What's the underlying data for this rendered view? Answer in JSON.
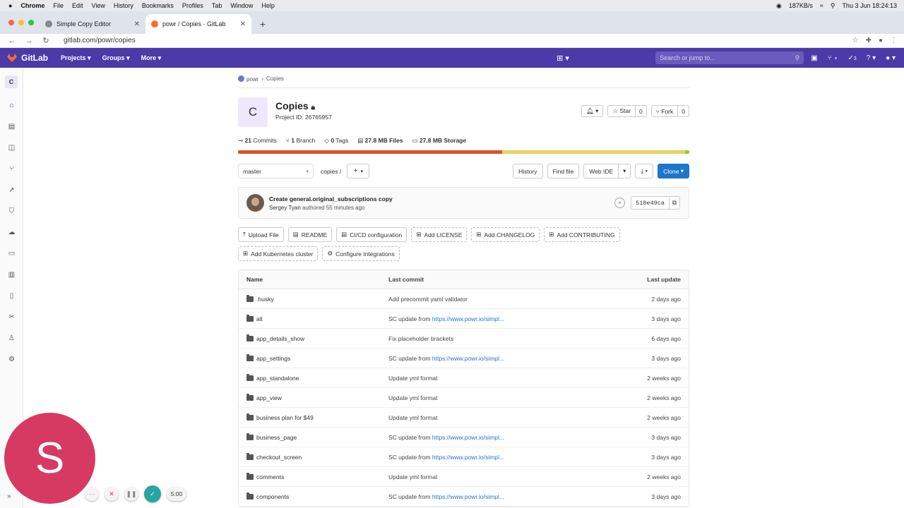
{
  "macos": {
    "apple": "",
    "menu": [
      "Chrome",
      "File",
      "Edit",
      "View",
      "History",
      "Bookmarks",
      "Profiles",
      "Tab",
      "Window",
      "Help"
    ],
    "network": "187KB/s",
    "datetime": "Thu 3 Jun  18:24:13"
  },
  "browser": {
    "tabs": [
      {
        "title": "Simple Copy Editor",
        "favicon_color": "#888888"
      },
      {
        "title": "powr / Copies · GitLab",
        "favicon_color": "#fc6d26"
      }
    ],
    "url": "gitlab.com/powr/copies"
  },
  "gitlab_nav": {
    "brand": "GitLab",
    "menu": [
      "Projects",
      "Groups",
      "More"
    ],
    "search_placeholder": "Search or jump to...",
    "todo_count": "3"
  },
  "sidebar": {
    "avatar_letter": "C"
  },
  "breadcrumb": {
    "group": "powr",
    "project": "Copies"
  },
  "project": {
    "avatar_letter": "C",
    "title": "Copies",
    "project_id": "Project ID: 26765957",
    "star_label": "Star",
    "star_count": "0",
    "fork_label": "Fork",
    "fork_count": "0"
  },
  "stats": {
    "commits_num": "21",
    "commits_label": "Commits",
    "branch_num": "1",
    "branch_label": "Branch",
    "tags_num": "0",
    "tags_label": "Tags",
    "files_num": "27.8 MB",
    "files_label": "Files",
    "storage_num": "27.8 MB",
    "storage_label": "Storage"
  },
  "language_bar": [
    {
      "color": "#d9512c",
      "fraction": 0.585
    },
    {
      "color": "#e6d35b",
      "fraction": 0.405
    },
    {
      "color": "#8ec63f",
      "fraction": 0.01
    }
  ],
  "toolbar": {
    "branch": "master",
    "path": "copies  /",
    "history": "History",
    "find_file": "Find file",
    "web_ide": "Web IDE",
    "clone": "Clone"
  },
  "last_commit": {
    "title": "Create general.original_subscriptions copy",
    "author": "Sergey Tyan",
    "meta": "authored 55 minutes ago",
    "sha": "518e49ca"
  },
  "quick_actions": [
    {
      "label": "Upload File",
      "style": "solid"
    },
    {
      "label": "README",
      "style": "solid"
    },
    {
      "label": "CI/CD configuration",
      "style": "solid"
    },
    {
      "label": "Add LICENSE",
      "style": "dashed"
    },
    {
      "label": "Add CHANGELOG",
      "style": "dashed"
    },
    {
      "label": "Add CONTRIBUTING",
      "style": "dashed"
    },
    {
      "label": "Add Kubernetes cluster",
      "style": "dashed"
    },
    {
      "label": "Configure Integrations",
      "style": "dashed"
    }
  ],
  "table": {
    "headers": {
      "name": "Name",
      "commit": "Last commit",
      "update": "Last update"
    },
    "rows": [
      {
        "name": ".husky",
        "commit": "Add precommit yaml validator",
        "link": "",
        "update": "2 days ago"
      },
      {
        "name": "all",
        "commit": "SC update from ",
        "link": "https://www.powr.io/simpl...",
        "update": "3 days ago"
      },
      {
        "name": "app_details_show",
        "commit": "Fix placeholder brackets",
        "link": "",
        "update": "6 days ago"
      },
      {
        "name": "app_settings",
        "commit": "SC update from ",
        "link": "https://www.powr.io/simpl...",
        "update": "3 days ago"
      },
      {
        "name": "app_standalone",
        "commit": "Update yml format",
        "link": "",
        "update": "2 weeks ago"
      },
      {
        "name": "app_view",
        "commit": "Update yml format",
        "link": "",
        "update": "2 weeks ago"
      },
      {
        "name": "business plan for $49",
        "commit": "Update yml format",
        "link": "",
        "update": "2 weeks ago"
      },
      {
        "name": "business_page",
        "commit": "SC update from ",
        "link": "https://www.powr.io/simpl...",
        "update": "3 days ago"
      },
      {
        "name": "checkout_screen",
        "commit": "SC update from ",
        "link": "https://www.powr.io/simpl...",
        "update": "3 days ago"
      },
      {
        "name": "comments",
        "commit": "Update yml format",
        "link": "",
        "update": "2 weeks ago"
      },
      {
        "name": "components",
        "commit": "SC update from ",
        "link": "https://www.powr.io/simpl...",
        "update": "3 days ago"
      }
    ]
  },
  "recorder": {
    "avatar_letter": "S",
    "timer": "5:00"
  }
}
